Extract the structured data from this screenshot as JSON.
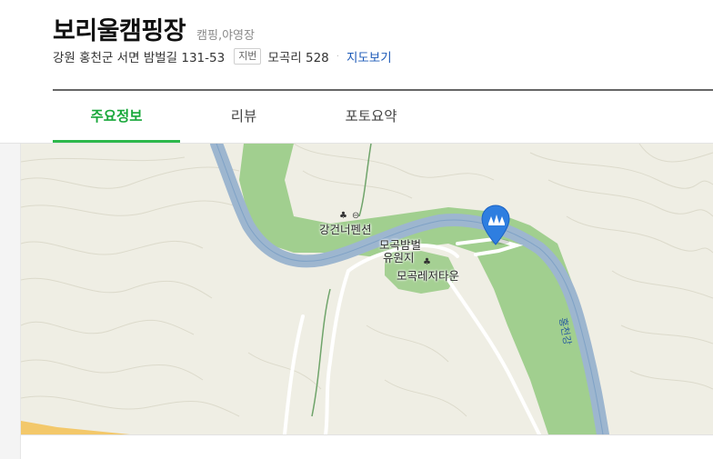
{
  "place": {
    "title": "보리울캠핑장",
    "category": "캠핑,야영장",
    "address": "강원 홍천군 서면 밤벌길 131-53",
    "jibun_badge": "지번",
    "jibun_address": "모곡리 528",
    "map_link": "지도보기"
  },
  "tabs": [
    {
      "label": "주요정보",
      "active": true
    },
    {
      "label": "리뷰",
      "active": false
    },
    {
      "label": "포토요약",
      "active": false
    }
  ],
  "map": {
    "labels": {
      "pension": "강건너펜션",
      "resort_line1": "모곡밤벌",
      "resort_line2": "유원지",
      "leisure": "모곡레저타운",
      "river": "홍천강"
    },
    "colors": {
      "land": "#efeee4",
      "forest": "#9ccc8a",
      "river": "#9db6cf",
      "road": "#ffffff",
      "pin": "#2e7ee0",
      "accent_tab": "#19a83b"
    },
    "pin_icon": "camping-tent-icon"
  }
}
